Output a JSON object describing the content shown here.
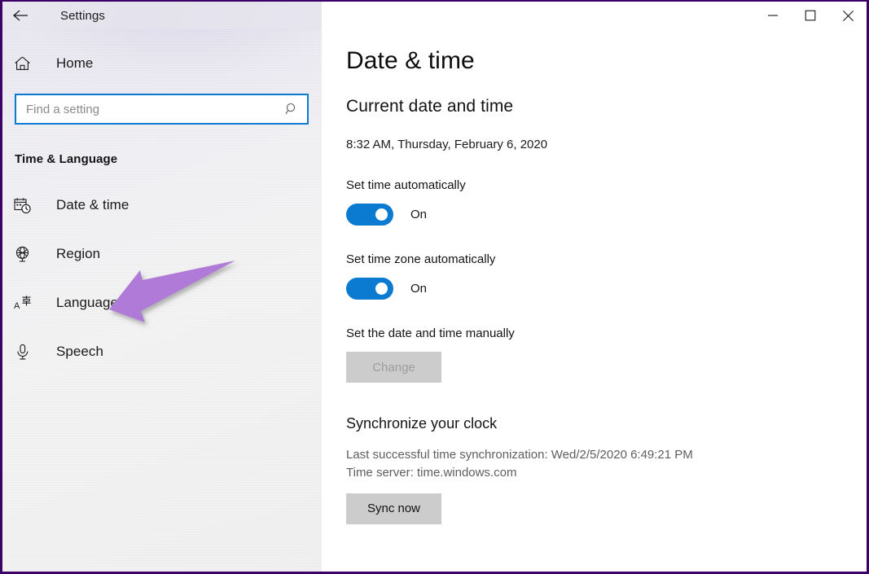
{
  "window": {
    "title": "Settings",
    "back_icon": "back-arrow-icon",
    "controls": {
      "minimize": "minimize-icon",
      "maximize": "maximize-icon",
      "close": "close-icon"
    },
    "border_color": "#3d0066"
  },
  "sidebar": {
    "home": {
      "label": "Home",
      "icon": "home-icon"
    },
    "search": {
      "value": "",
      "placeholder": "Find a setting",
      "icon": "search-icon",
      "focus_border_color": "#0a7bd0"
    },
    "category": "Time & Language",
    "items": [
      {
        "label": "Date & time",
        "icon": "calendar-clock-icon",
        "selected": true
      },
      {
        "label": "Region",
        "icon": "globe-icon",
        "selected": false
      },
      {
        "label": "Language",
        "icon": "language-icon",
        "selected": false
      },
      {
        "label": "Speech",
        "icon": "microphone-icon",
        "selected": false
      }
    ]
  },
  "annotation": {
    "type": "arrow",
    "points_to": "Language",
    "color": "#b07ad8"
  },
  "main": {
    "page_title": "Date & time",
    "current": {
      "section_title": "Current date and time",
      "datetime": "8:32 AM, Thursday, February 6, 2020"
    },
    "set_time_auto": {
      "label": "Set time automatically",
      "state": "On",
      "toggle_color": "#0a7bd0"
    },
    "set_timezone_auto": {
      "label": "Set time zone automatically",
      "state": "On",
      "toggle_color": "#0a7bd0"
    },
    "manual": {
      "label": "Set the date and time manually",
      "button_label": "Change",
      "button_disabled": true
    },
    "sync": {
      "title": "Synchronize your clock",
      "last_sync": "Last successful time synchronization: Wed/2/5/2020 6:49:21 PM",
      "time_server": "Time server: time.windows.com",
      "button_label": "Sync now"
    }
  }
}
